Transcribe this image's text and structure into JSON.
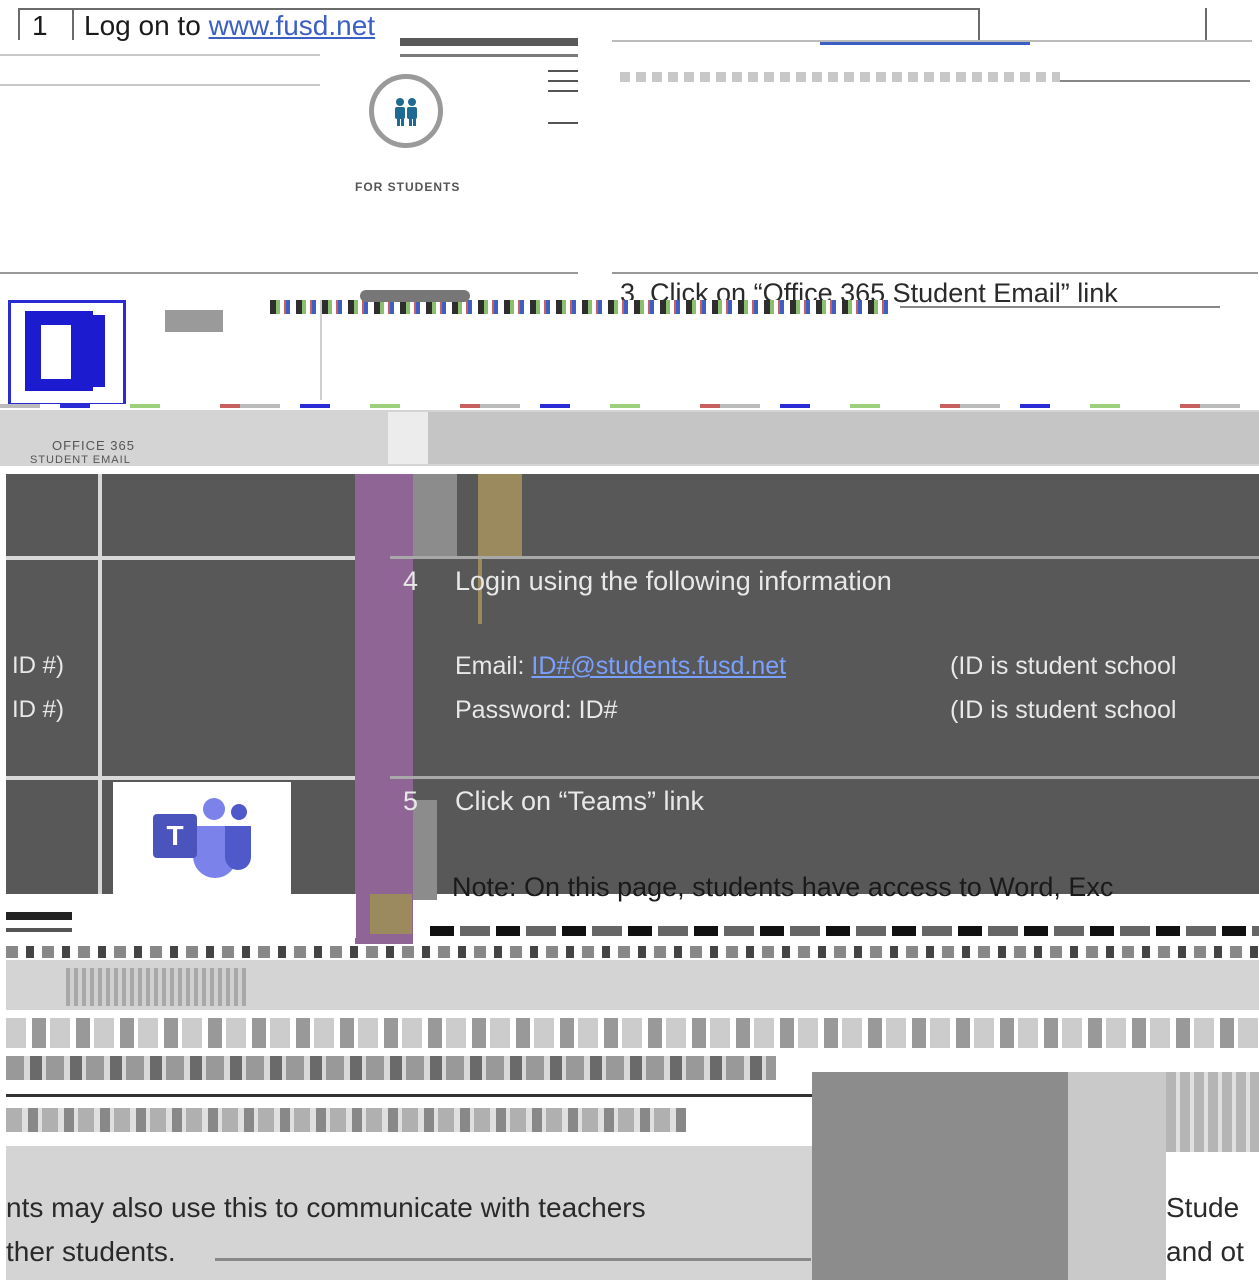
{
  "step1": {
    "number": "1",
    "prefix": "Log on to ",
    "link": "www.fusd.net"
  },
  "students_tile": {
    "label": "FOR STUDENTS",
    "icon": "people-icon"
  },
  "step3": {
    "number": "3",
    "text": "Click on “Office 365 Student Email” link"
  },
  "office_tile": {
    "label_line1": "OFFICE 365",
    "label_line2": "STUDENT EMAIL",
    "icon": "office-door-icon"
  },
  "step4": {
    "number": "4",
    "text": "Login using the following information",
    "email_label": "Email: ",
    "email_value": "ID#@students.fusd.net",
    "email_note": "(ID is student school",
    "password_label": "Password: ID#",
    "password_note": "(ID is student school"
  },
  "left_fragments": {
    "id1": "ID #)",
    "id2": "ID #)",
    "bottom_line1": "nts may also use this to communicate with teachers",
    "bottom_line2": "ther students."
  },
  "step5": {
    "number": "5",
    "text": "Click on “Teams” link",
    "note": "Note: On this page, students have access to Word, Exc"
  },
  "teams_tile": {
    "icon": "teams-icon",
    "letter": "T"
  },
  "right_fragment": {
    "line1": "Stude",
    "line2": "and ot"
  },
  "colors": {
    "purple": "#8e6594",
    "tan": "#9c8a5f",
    "dark_gray": "#585858",
    "link_blue": "#3b5fc4",
    "teams_purple": "#5059c9"
  }
}
